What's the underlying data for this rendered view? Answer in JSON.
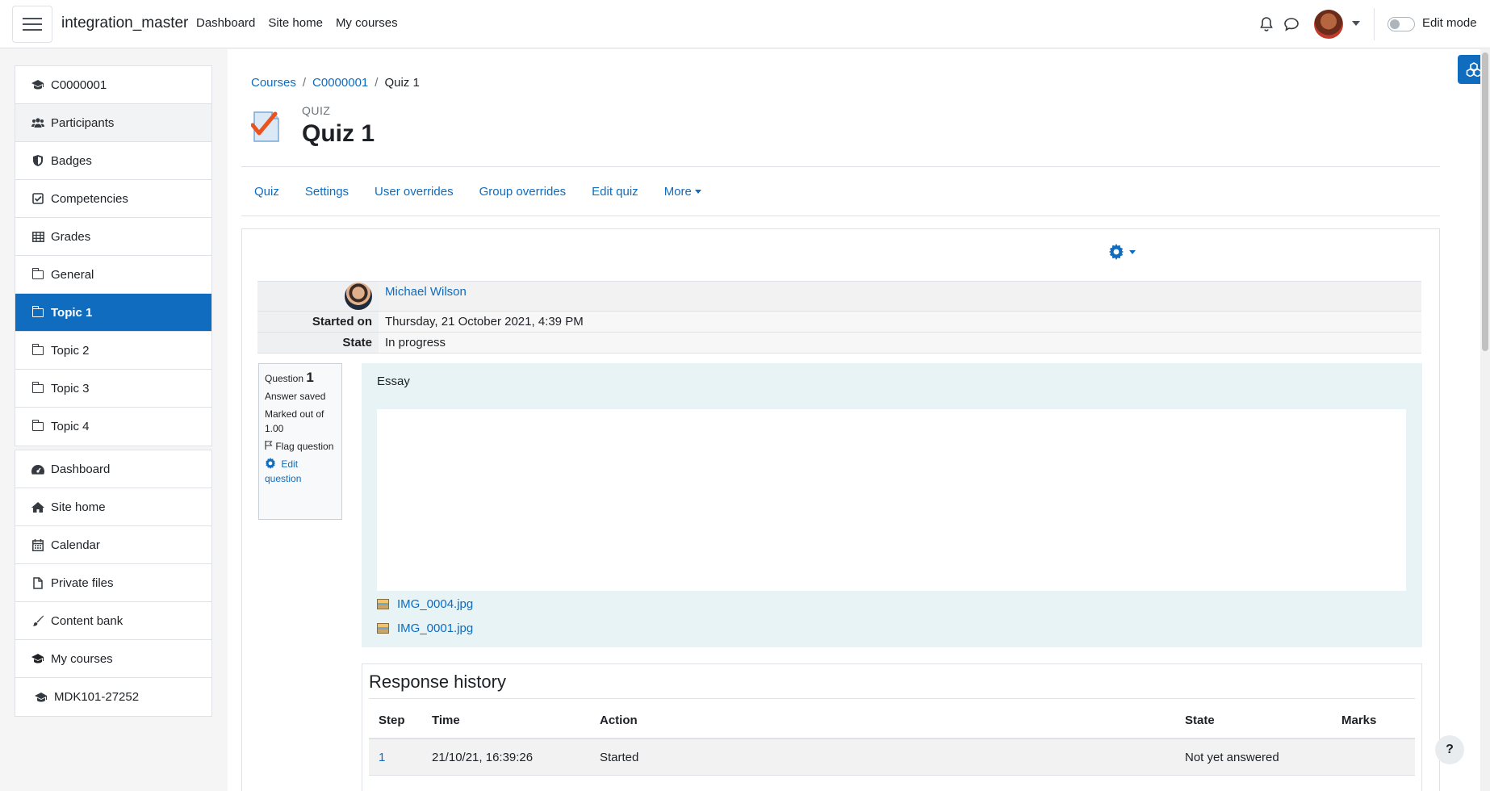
{
  "navbar": {
    "site_name": "integration_master",
    "links": [
      "Dashboard",
      "Site home",
      "My courses"
    ],
    "edit_mode_label": "Edit mode"
  },
  "drawer": {
    "course_items": [
      {
        "label": "C0000001",
        "icon": "graduation-cap-icon"
      },
      {
        "label": "Participants",
        "icon": "users-icon"
      },
      {
        "label": "Badges",
        "icon": "shield-icon"
      },
      {
        "label": "Competencies",
        "icon": "check-square-icon"
      },
      {
        "label": "Grades",
        "icon": "table-icon"
      },
      {
        "label": "General",
        "icon": "folder-icon"
      },
      {
        "label": "Topic 1",
        "icon": "folder-icon",
        "active": true
      },
      {
        "label": "Topic 2",
        "icon": "folder-icon"
      },
      {
        "label": "Topic 3",
        "icon": "folder-icon"
      },
      {
        "label": "Topic 4",
        "icon": "folder-icon"
      }
    ],
    "site_items": [
      {
        "label": "Dashboard",
        "icon": "dashboard-icon"
      },
      {
        "label": "Site home",
        "icon": "home-icon"
      },
      {
        "label": "Calendar",
        "icon": "calendar-icon"
      },
      {
        "label": "Private files",
        "icon": "file-icon"
      },
      {
        "label": "Content bank",
        "icon": "brush-icon"
      },
      {
        "label": "My courses",
        "icon": "graduation-cap-icon"
      },
      {
        "label": "MDK101-27252",
        "icon": "graduation-cap-icon"
      }
    ]
  },
  "breadcrumb": [
    "Courses",
    "C0000001",
    "Quiz 1"
  ],
  "page": {
    "module_label": "QUIZ",
    "title": "Quiz 1"
  },
  "secondary_nav": [
    "Quiz",
    "Settings",
    "User overrides",
    "Group overrides",
    "Edit quiz",
    "More"
  ],
  "attempt_summary": {
    "user_name": "Michael Wilson",
    "started_on_label": "Started on",
    "started_on_value": "Thursday, 21 October 2021, 4:39 PM",
    "state_label": "State",
    "state_value": "In progress"
  },
  "question_info": {
    "question_label": "Question",
    "question_number": "1",
    "status": "Answer saved",
    "marked_out_of": "Marked out of 1.00",
    "flag_label": "Flag question",
    "edit_label": "Edit question"
  },
  "question": {
    "type": "Essay",
    "attachments": [
      "IMG_0004.jpg",
      "IMG_0001.jpg"
    ]
  },
  "response_history": {
    "title": "Response history",
    "columns": [
      "Step",
      "Time",
      "Action",
      "State",
      "Marks"
    ],
    "rows": [
      {
        "step": "1",
        "time": "21/10/21, 16:39:26",
        "action": "Started",
        "state": "Not yet answered",
        "marks": ""
      }
    ]
  },
  "colors": {
    "brand": "#0f6cbf",
    "question_bg": "#e7f3f5"
  }
}
